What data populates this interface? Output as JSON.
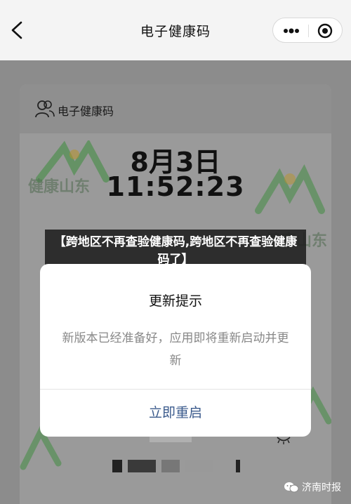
{
  "nav": {
    "title": "电子健康码"
  },
  "card": {
    "header_label": "电子健康码",
    "date": "8月3日",
    "time": "11:52:23",
    "watermark_text": "健康山东"
  },
  "banner": {
    "headline": "【跨地区不再查验健康码,跨地区不再查验健康码了】"
  },
  "modal": {
    "title": "更新提示",
    "message": "新版本已经准备好，应用即将重新启动并更新",
    "button": "立即重启"
  },
  "source": {
    "label": "济南时报"
  }
}
